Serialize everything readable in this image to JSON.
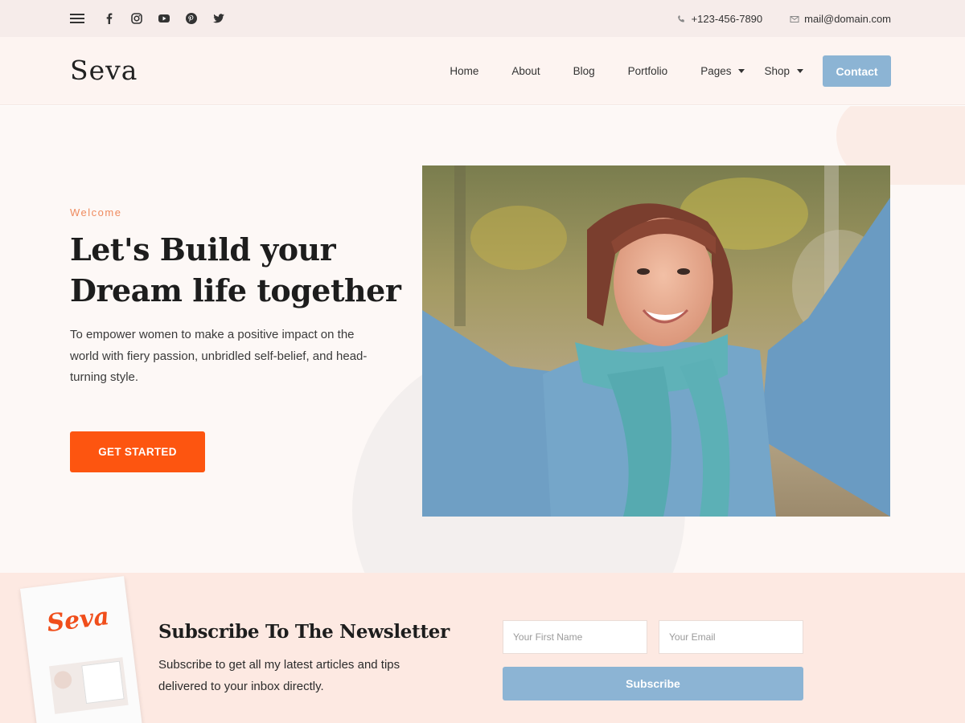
{
  "topbar": {
    "menu_icon": "hamburger-icon",
    "social": [
      "facebook-icon",
      "instagram-icon",
      "youtube-icon",
      "pinterest-icon",
      "twitter-icon"
    ],
    "phone": "+123-456-7890",
    "email": "mail@domain.com"
  },
  "header": {
    "logo": "Seva",
    "nav": {
      "home": "Home",
      "about": "About",
      "blog": "Blog",
      "portfolio": "Portfolio",
      "pages": "Pages",
      "shop": "Shop",
      "contact": "Contact"
    }
  },
  "hero": {
    "eyebrow": "Welcome",
    "title": "Let's Build your Dream life together",
    "description": "To empower women to make a positive impact on the world with fiery passion, unbridled self-belief, and head-turning style.",
    "cta": "GET STARTED"
  },
  "newsletter": {
    "magazine_logo": "Seva",
    "title": "Subscribe To The Newsletter",
    "description": "Subscribe to get all my latest articles and tips delivered to your inbox directly.",
    "first_name_placeholder": "Your First Name",
    "email_placeholder": "Your Email",
    "button": "Subscribe"
  },
  "colors": {
    "accent_orange": "#fd5510",
    "accent_blue": "#8cb4d4",
    "eyebrow": "#ef8b5f"
  }
}
